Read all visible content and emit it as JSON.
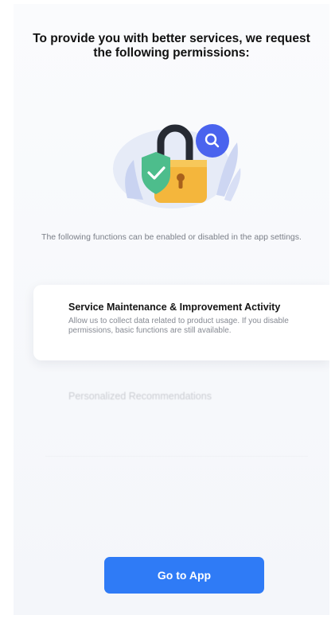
{
  "header": {
    "title": "To provide you with better services, we request the following permissions:"
  },
  "hero": {
    "icon": "padlock-shield-search-illustration",
    "colors": {
      "lock": "#f4b63c",
      "shield": "#4dbd8c",
      "search_badge": "#4a63ee"
    }
  },
  "intro_note": "The following functions can be enabled or disabled in the app settings.",
  "permissions": [
    {
      "title": "Service Maintenance & Improvement Activity",
      "description": "Allow us to collect data related to product usage. If you disable permissions, basic functions are still available.",
      "state": "active"
    },
    {
      "title": "Personalized Recommendations",
      "description": "",
      "state": "faded"
    }
  ],
  "cta": {
    "label": "Go to App",
    "color": "#2f7bf6"
  }
}
